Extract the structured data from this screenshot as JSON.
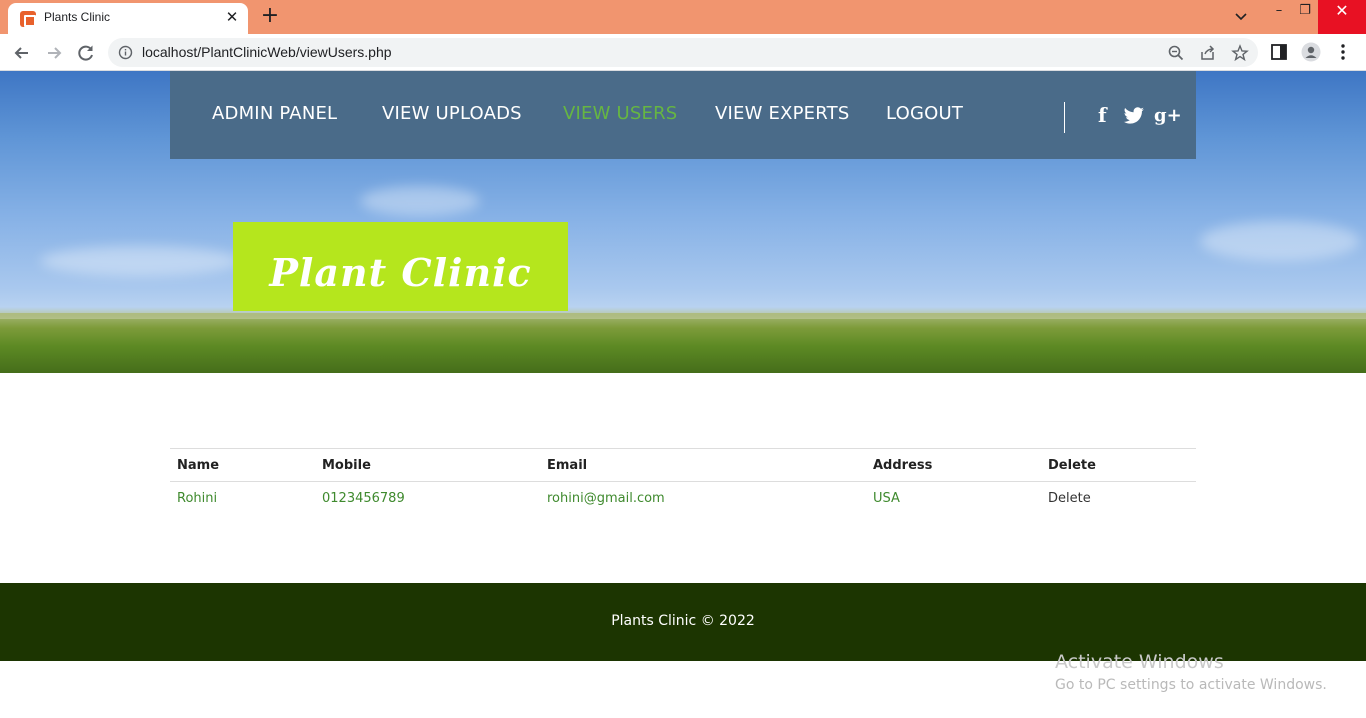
{
  "browser": {
    "tab_title": "Plants Clinic",
    "tab_close": "✕",
    "new_tab": "+",
    "url": "localhost/PlantClinicWeb/viewUsers.php",
    "window": {
      "minimize": "–",
      "maximize": "❐",
      "close": "✕"
    }
  },
  "nav": {
    "items": [
      {
        "label": "ADMIN PANEL"
      },
      {
        "label": "VIEW UPLOADS"
      },
      {
        "label": "VIEW USERS"
      },
      {
        "label": "VIEW EXPERTS"
      },
      {
        "label": "LOGOUT"
      }
    ],
    "social": {
      "facebook": "f",
      "twitter": "twitter-icon",
      "google_plus": "g+"
    }
  },
  "logo": {
    "text": "Plant Clinic"
  },
  "table": {
    "headers": [
      "Name",
      "Mobile",
      "Email",
      "Address",
      "Delete"
    ],
    "rows": [
      [
        "Rohini",
        "0123456789",
        "rohini@gmail.com",
        "USA",
        "Delete"
      ]
    ]
  },
  "footer": {
    "text": "Plants Clinic © 2022"
  },
  "os_watermark": {
    "line1": "Activate Windows",
    "line2": "Go to PC settings to activate Windows."
  },
  "colors": {
    "titlebar": "#f1956f",
    "navbar": "#4a6b89",
    "active_nav": "#66b642",
    "logo_bg": "#b5e61d",
    "link_green": "#3f8a2e",
    "footer": "#1c3501"
  }
}
